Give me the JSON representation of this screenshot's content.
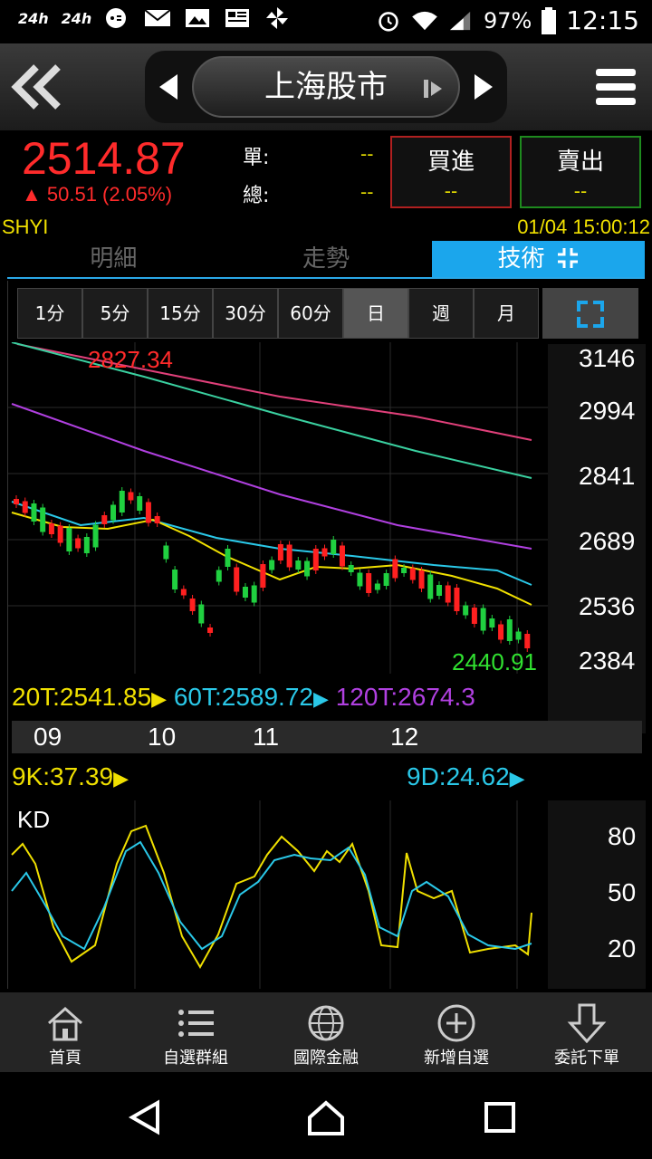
{
  "status_bar": {
    "left_labels": [
      "24h",
      "24h"
    ],
    "battery": "97%",
    "time": "12:15"
  },
  "header": {
    "title": "上海股市"
  },
  "quote": {
    "price": "2514.87",
    "change": "▲ 50.51 (2.05%)",
    "single_label": "單:",
    "single_value": "--",
    "total_label": "總:",
    "total_value": "--",
    "buy_label": "買進",
    "buy_value": "--",
    "sell_label": "賣出",
    "sell_value": "--"
  },
  "symbol": {
    "code": "SHYI",
    "datetime": "01/04 15:00:12"
  },
  "tabs": [
    "明細",
    "走勢",
    "技術"
  ],
  "periods": [
    "1分",
    "5分",
    "15分",
    "30分",
    "60分",
    "日",
    "週",
    "月"
  ],
  "active_period": "日",
  "chart": {
    "y_labels": [
      "3146",
      "2994",
      "2841",
      "2689",
      "2536",
      "2384"
    ],
    "high_label": "2827.34",
    "low_label": "2440.91",
    "ma20": "20T:2541.85",
    "ma60": "60T:2589.72",
    "ma120": "120T:2674.3",
    "x_labels": [
      "09",
      "10",
      "11",
      "12"
    ],
    "k_value": "9K:37.39",
    "d_value": "9D:24.62",
    "kd_title": "KD",
    "kd_labels": [
      "80",
      "50",
      "20"
    ],
    "colors": {
      "ma20": "#f0e000",
      "ma60": "#2ac8e8",
      "ma120": "#b040e0",
      "up": "#ff2020",
      "down": "#20d040"
    }
  },
  "chart_data": {
    "type": "candlestick",
    "x_labels": [
      "09",
      "10",
      "11",
      "12"
    ],
    "ylim": [
      2384,
      3146
    ],
    "y_ticks": [
      3146,
      2994,
      2841,
      2689,
      2536,
      2384
    ],
    "high": 2827.34,
    "low": 2440.91,
    "close": 2514.87,
    "series": [
      {
        "name": "20T",
        "last": 2541.85
      },
      {
        "name": "60T",
        "last": 2589.72
      },
      {
        "name": "120T",
        "last": 2674.3
      }
    ],
    "kd": {
      "K": 37.39,
      "D": 24.62,
      "y_ticks": [
        80,
        50,
        20
      ]
    }
  },
  "bottom_nav": [
    {
      "label": "首頁",
      "icon": "home-icon"
    },
    {
      "label": "自選群組",
      "icon": "list-icon"
    },
    {
      "label": "國際金融",
      "icon": "globe-icon"
    },
    {
      "label": "新增自選",
      "icon": "plus-circle-icon"
    },
    {
      "label": "委託下單",
      "icon": "order-down-icon"
    }
  ]
}
